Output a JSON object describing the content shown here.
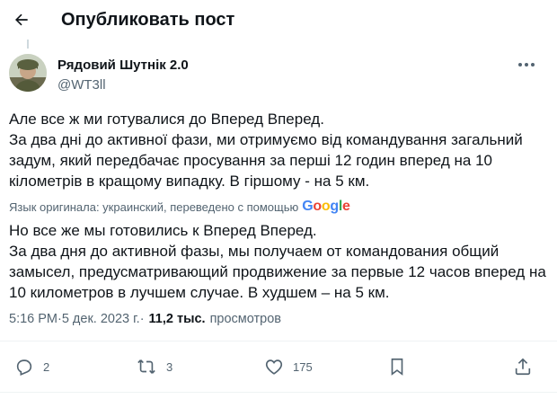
{
  "header": {
    "title": "Опубликовать пост",
    "back_icon": "arrow-left-icon"
  },
  "author": {
    "name": "Рядовий Шутнік 2.0",
    "handle": "@WT3ll"
  },
  "post": {
    "original_text": "Але все ж ми готувалися до Вперед Вперед.\nЗа два дні до активної фази, ми отримуємо від командування загальний задум, який передбачає просування за перші 12 годин вперед на 10 кілометрів в кращому випадку. В гіршому - на 5 км.",
    "translation_note": "Язык оригинала: украинский, переведено с помощью",
    "translation_provider": "Google",
    "translated_text": "Но все же мы готовились к Вперед Вперед.\nЗа два дня до активной фазы, мы получаем от командования общий замысел, предусматривающий продвижение за первые 12 часов вперед на 10 километров в лучшем случае. В худшем – на 5 км.",
    "time": "5:16 PM",
    "separator": " · ",
    "date": "5 дек. 2023 г.",
    "views_count": "11,2 тыс.",
    "views_label": "просмотров"
  },
  "actions": {
    "replies": "2",
    "reposts": "3",
    "likes": "175"
  },
  "colors": {
    "text": "#0f1419",
    "secondary": "#536471",
    "google_blue": "#4285F4",
    "google_red": "#EA4335",
    "google_yellow": "#FBBC05",
    "google_green": "#34A853"
  }
}
